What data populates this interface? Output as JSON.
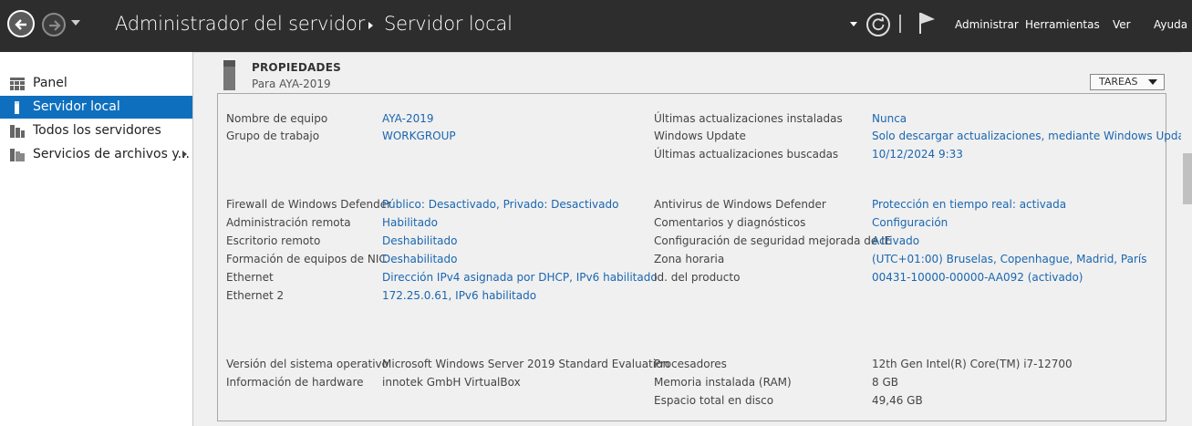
{
  "header": {
    "crumb_1": "Administrador del servidor",
    "crumb_2": "Servidor local",
    "menu": [
      "Administrar",
      "Herramientas",
      "Ver",
      "Ayuda"
    ]
  },
  "sidebar": {
    "items": [
      {
        "label": "Panel",
        "icon": "dashboard-icon"
      },
      {
        "label": "Servidor local",
        "icon": "local-server-icon"
      },
      {
        "label": "Todos los servidores",
        "icon": "all-servers-icon"
      },
      {
        "label": "Servicios de archivos y...",
        "icon": "file-services-icon"
      }
    ],
    "active_index": 1
  },
  "properties": {
    "title": "PROPIEDADES",
    "subtitle": "Para AYA-2019",
    "tasks_label": "TAREAS",
    "left_groups": [
      [
        {
          "label": "Nombre de equipo",
          "value": "AYA-2019"
        },
        {
          "label": "Grupo de trabajo",
          "value": "WORKGROUP"
        }
      ],
      [
        {
          "label": "Firewall de Windows Defender",
          "value": "Público: Desactivado, Privado: Desactivado"
        },
        {
          "label": "Administración remota",
          "value": "Habilitado"
        },
        {
          "label": "Escritorio remoto",
          "value": "Deshabilitado"
        },
        {
          "label": "Formación de equipos de NIC",
          "value": "Deshabilitado"
        },
        {
          "label": "Ethernet",
          "value": "Dirección IPv4 asignada por DHCP, IPv6 habilitado"
        },
        {
          "label": "Ethernet 2",
          "value": "172.25.0.61, IPv6 habilitado"
        }
      ],
      [
        {
          "label": "Versión del sistema operativo",
          "value": "Microsoft Windows Server 2019 Standard Evaluation"
        },
        {
          "label": "Información de hardware",
          "value": "innotek GmbH VirtualBox"
        }
      ]
    ],
    "right_groups": [
      [
        {
          "label": "Últimas actualizaciones instaladas",
          "value": "Nunca"
        },
        {
          "label": "Windows Update",
          "value": "Solo descargar actualizaciones, mediante Windows Update"
        },
        {
          "label": "Últimas actualizaciones buscadas",
          "value": "10/12/2024 9:33"
        }
      ],
      [
        {
          "label": "Antivirus de Windows Defender",
          "value": "Protección en tiempo real: activada"
        },
        {
          "label": "Comentarios y diagnósticos",
          "value": "Configuración"
        },
        {
          "label": "Configuración de seguridad mejorada de IE",
          "value": "Activado"
        },
        {
          "label": "Zona horaria",
          "value": "(UTC+01:00) Bruselas, Copenhague, Madrid, París"
        },
        {
          "label": "Id. del producto",
          "value": "00431-10000-00000-AA092 (activado)"
        }
      ],
      [
        {
          "label": "Procesadores",
          "value": "12th Gen Intel(R) Core(TM) i7-12700"
        },
        {
          "label": "Memoria instalada (RAM)",
          "value": "8 GB"
        },
        {
          "label": "Espacio total en disco",
          "value": "49,46 GB"
        }
      ]
    ]
  }
}
